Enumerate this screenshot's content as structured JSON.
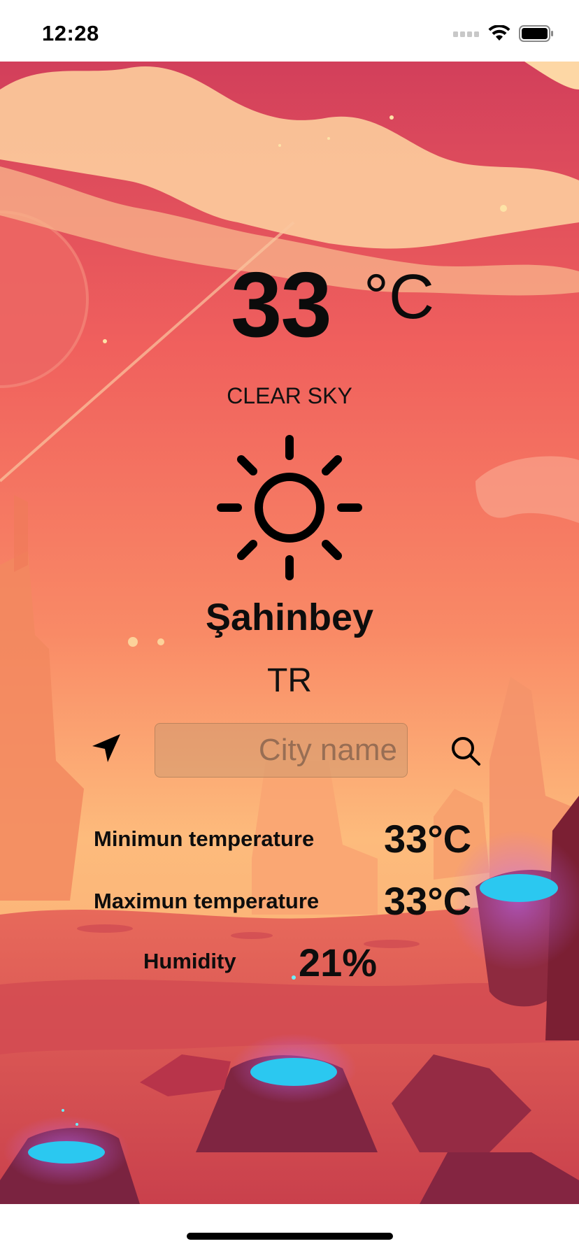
{
  "status_bar": {
    "time": "12:28",
    "icons": [
      "signal-icon",
      "wifi-icon",
      "battery-icon"
    ]
  },
  "weather": {
    "temperature": "33",
    "unit": "°C",
    "condition": "CLEAR SKY",
    "icon": "sun-icon",
    "city": "Şahinbey",
    "country": "TR"
  },
  "search": {
    "placeholder": "City name",
    "value": ""
  },
  "details": {
    "min_label": "Minimun temperature",
    "min_value": "33°C",
    "max_label": "Maximun temperature",
    "max_value": "33°C",
    "humidity_label": "Humidity",
    "humidity_value": "21%"
  },
  "colors": {
    "sky_top": "#d4405a",
    "sky_mid": "#f26a5e",
    "horizon": "#fbb47a",
    "ground": "#d7504f",
    "pool": "#2bc8f0"
  }
}
